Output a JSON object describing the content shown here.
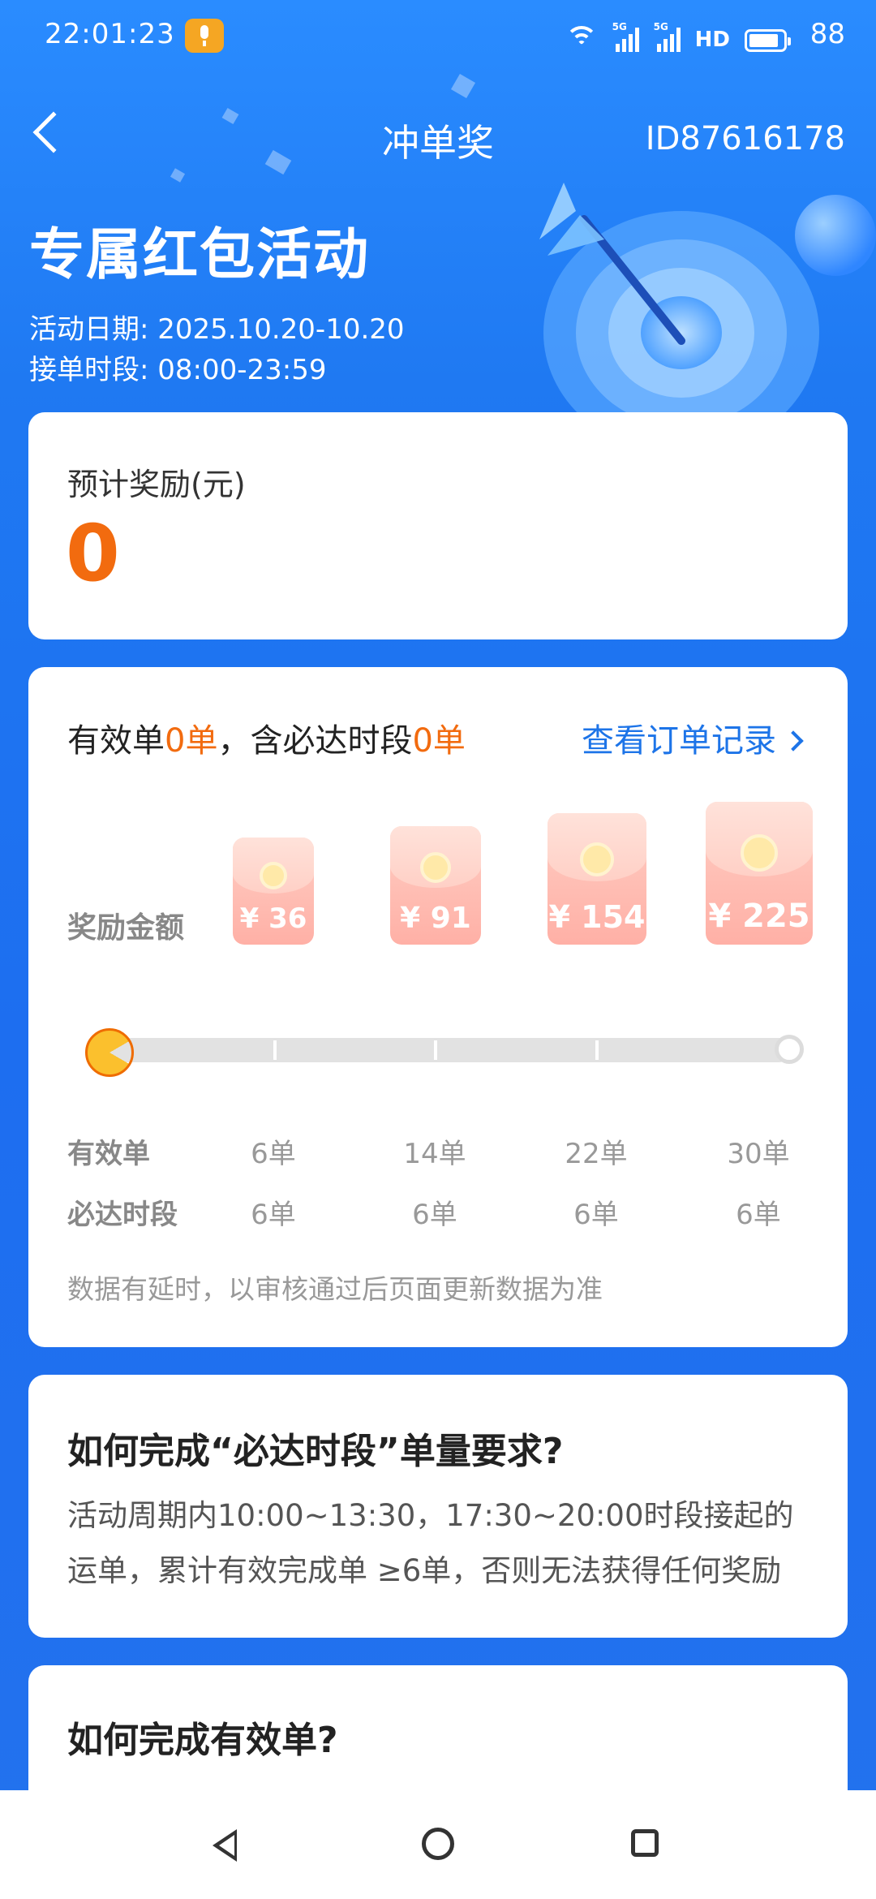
{
  "status_bar": {
    "time": "22:01:23",
    "hd_label": "HD",
    "battery": "88",
    "signal_label": "5G"
  },
  "header": {
    "title": "冲单奖",
    "id_text": "ID87616178"
  },
  "hero": {
    "title": "专属红包活动",
    "date_line": "活动日期: 2025.10.20-10.20",
    "time_line": "接单时段: 08:00-23:59"
  },
  "estimate": {
    "label": "预计奖励(元)",
    "value": "0"
  },
  "progress": {
    "head_prefix": "有效单",
    "valid_count": "0单",
    "head_middle": "，含必达时段",
    "required_count": "0单",
    "link": "查看订单记录",
    "reward_label": "奖励金额",
    "tiers": [
      {
        "amount": "¥ 36",
        "valid": "6单",
        "required": "6单"
      },
      {
        "amount": "¥ 91",
        "valid": "14单",
        "required": "6单"
      },
      {
        "amount": "¥ 154",
        "valid": "22单",
        "required": "6单"
      },
      {
        "amount": "¥ 225",
        "valid": "30单",
        "required": "6单"
      }
    ],
    "row_valid_label": "有效单",
    "row_required_label": "必达时段",
    "note": "数据有延时，以审核通过后页面更新数据为准",
    "current_fraction": 0
  },
  "faq1": {
    "title": "如何完成“必达时段”单量要求?",
    "body": "活动周期内10:00~13:30，17:30~20:00时段接起的运单，累计有效完成单 ≥6单，否则无法获得任何奖励"
  },
  "faq2": {
    "title": "如何完成有效单?"
  },
  "colors": {
    "accent_orange": "#f26b0f",
    "link_blue": "#1d74e8",
    "background_blue": "#1f79f2"
  }
}
